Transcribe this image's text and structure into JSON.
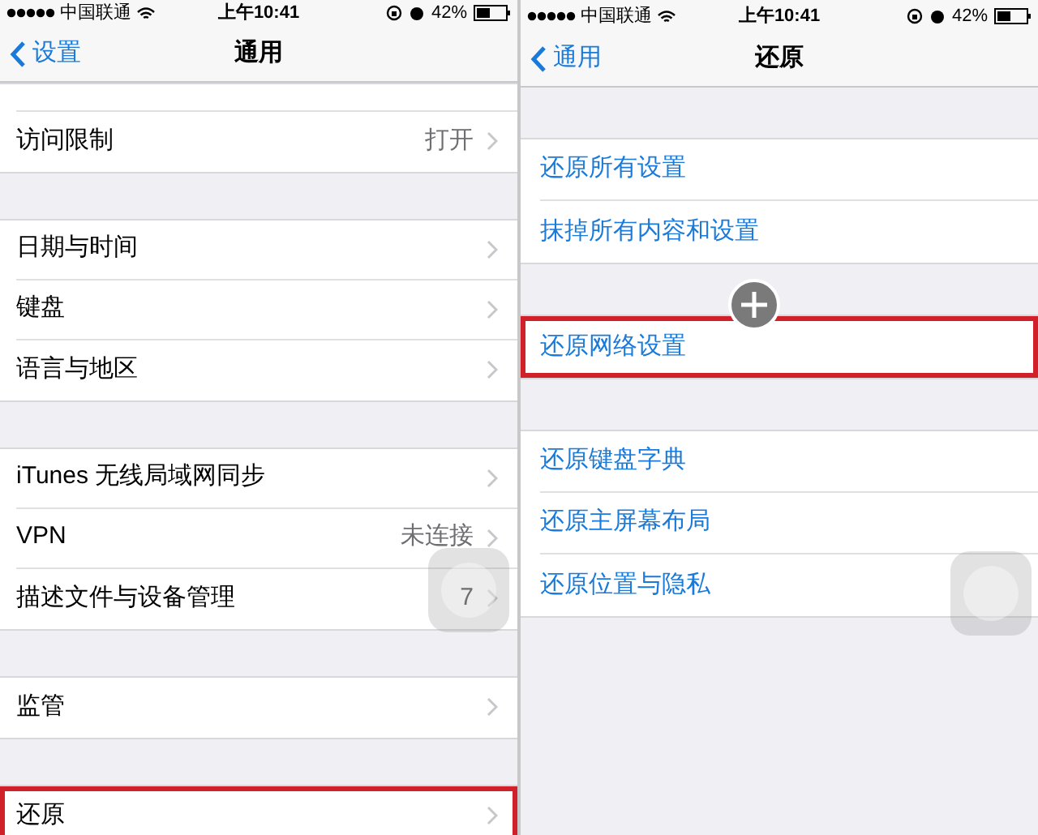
{
  "screens": [
    {
      "status_bar": {
        "carrier": "中国联通",
        "time": "上午10:41",
        "battery": "42%"
      },
      "nav": {
        "back": "设置",
        "title": "通用"
      },
      "groups": [
        {
          "items": [
            {
              "kind": "cut",
              "highlighted": false
            },
            {
              "kind": "detail",
              "label": "访问限制",
              "value": "打开",
              "highlighted": false
            }
          ]
        },
        {
          "items": [
            {
              "kind": "detail",
              "label": "日期与时间",
              "highlighted": false
            },
            {
              "kind": "detail",
              "label": "键盘",
              "highlighted": false
            },
            {
              "kind": "detail",
              "label": "语言与地区",
              "highlighted": false
            }
          ]
        },
        {
          "items": [
            {
              "kind": "detail",
              "label": "iTunes 无线局域网同步",
              "highlighted": false
            },
            {
              "kind": "detail",
              "label": "VPN",
              "value": "未连接",
              "highlighted": false
            },
            {
              "kind": "detail",
              "label": "描述文件与设备管理",
              "value": "7",
              "highlighted": false
            }
          ]
        },
        {
          "items": [
            {
              "kind": "detail",
              "label": "监管",
              "highlighted": false
            }
          ]
        },
        {
          "items": [
            {
              "kind": "detail",
              "label": "还原",
              "highlighted": true
            }
          ]
        }
      ]
    },
    {
      "status_bar": {
        "carrier": "中国联通",
        "time": "上午10:41",
        "battery": "42%"
      },
      "nav": {
        "back": "通用",
        "title": "还原"
      },
      "groups": [
        {
          "items": [
            {
              "kind": "action",
              "label": "还原所有设置",
              "highlighted": false
            },
            {
              "kind": "action",
              "label": "抹掉所有内容和设置",
              "highlighted": false
            }
          ]
        },
        {
          "items": [
            {
              "kind": "action",
              "label": "还原网络设置",
              "highlighted": true
            }
          ]
        },
        {
          "items": [
            {
              "kind": "action",
              "label": "还原键盘字典",
              "highlighted": false
            },
            {
              "kind": "action",
              "label": "还原主屏幕布局",
              "highlighted": false
            },
            {
              "kind": "action",
              "label": "还原位置与隐私",
              "highlighted": false
            }
          ]
        }
      ]
    }
  ]
}
